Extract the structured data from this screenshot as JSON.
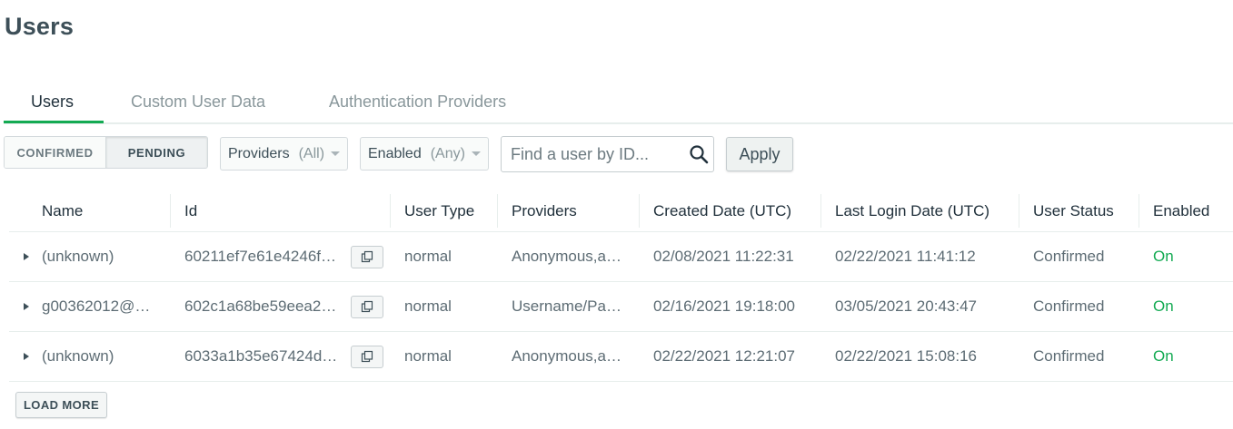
{
  "page": {
    "title": "Users"
  },
  "tabs": [
    {
      "label": "Users",
      "active": true
    },
    {
      "label": "Custom User Data",
      "active": false
    },
    {
      "label": "Authentication Providers",
      "active": false
    }
  ],
  "filters": {
    "status_toggle": {
      "options": [
        "CONFIRMED",
        "PENDING"
      ],
      "selected": "PENDING"
    },
    "providers": {
      "label": "Providers",
      "value": "(All)"
    },
    "enabled": {
      "label": "Enabled",
      "value": "(Any)"
    },
    "search": {
      "placeholder": "Find a user by ID...",
      "value": ""
    },
    "apply_label": "Apply"
  },
  "table": {
    "columns": [
      "Name",
      "Id",
      "User Type",
      "Providers",
      "Created Date (UTC)",
      "Last Login Date (UTC)",
      "User Status",
      "Enabled"
    ],
    "rows": [
      {
        "name": "(unknown)",
        "id": "60211ef7e61e4246f…",
        "user_type": "normal",
        "providers": "Anonymous,an…",
        "created": "02/08/2021 11:22:31",
        "last_login": "02/22/2021 11:41:12",
        "status": "Confirmed",
        "enabled": "On"
      },
      {
        "name": "g00362012@…",
        "id": "602c1a68be59eea2…",
        "user_type": "normal",
        "providers": "Username/Pas…",
        "created": "02/16/2021 19:18:00",
        "last_login": "03/05/2021 20:43:47",
        "status": "Confirmed",
        "enabled": "On"
      },
      {
        "name": "(unknown)",
        "id": "6033a1b35e67424d…",
        "user_type": "normal",
        "providers": "Anonymous,an…",
        "created": "02/22/2021 12:21:07",
        "last_login": "02/22/2021 15:08:16",
        "status": "Confirmed",
        "enabled": "On"
      }
    ]
  },
  "load_more_label": "LOAD MORE",
  "colors": {
    "accent": "#13aa52",
    "enabled_on": "#13aa52",
    "text": "#3d4f58",
    "muted": "#89979b"
  },
  "icons": {
    "search": "search-icon",
    "copy": "copy-icon",
    "expand": "expand-arrow-icon",
    "caret": "chevron-down-icon"
  }
}
